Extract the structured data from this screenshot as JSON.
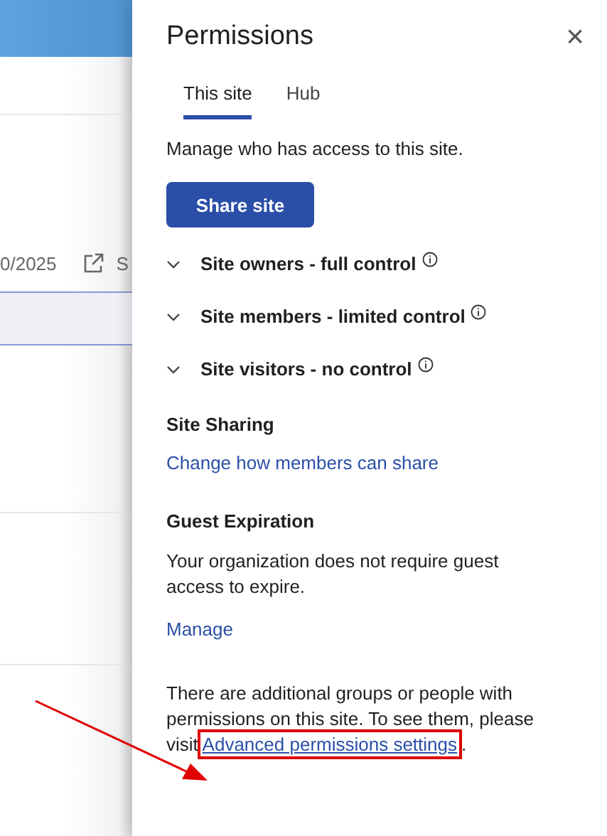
{
  "background": {
    "date": "0/2025",
    "share_label": "S"
  },
  "panel": {
    "title": "Permissions",
    "close": "×",
    "tabs": [
      {
        "label": "This site",
        "selected": true
      },
      {
        "label": "Hub",
        "selected": false
      }
    ],
    "intro": "Manage who has access to this site.",
    "share_button": "Share site",
    "groups": [
      {
        "label": "Site owners - full control",
        "expanded": false
      },
      {
        "label": "Site members - limited control",
        "expanded": false
      },
      {
        "label": "Site visitors - no control",
        "expanded": false
      }
    ],
    "sections": [
      {
        "heading": "Site Sharing",
        "link": "Change how members can share"
      },
      {
        "heading": "Guest Expiration",
        "text": "Your organization does not require guest access to expire.",
        "link": "Manage"
      }
    ],
    "footer": {
      "text": "There are additional groups or people with permissions on this site. To see them, please visit ",
      "link": "Advanced permissions settings",
      "after": "."
    }
  }
}
